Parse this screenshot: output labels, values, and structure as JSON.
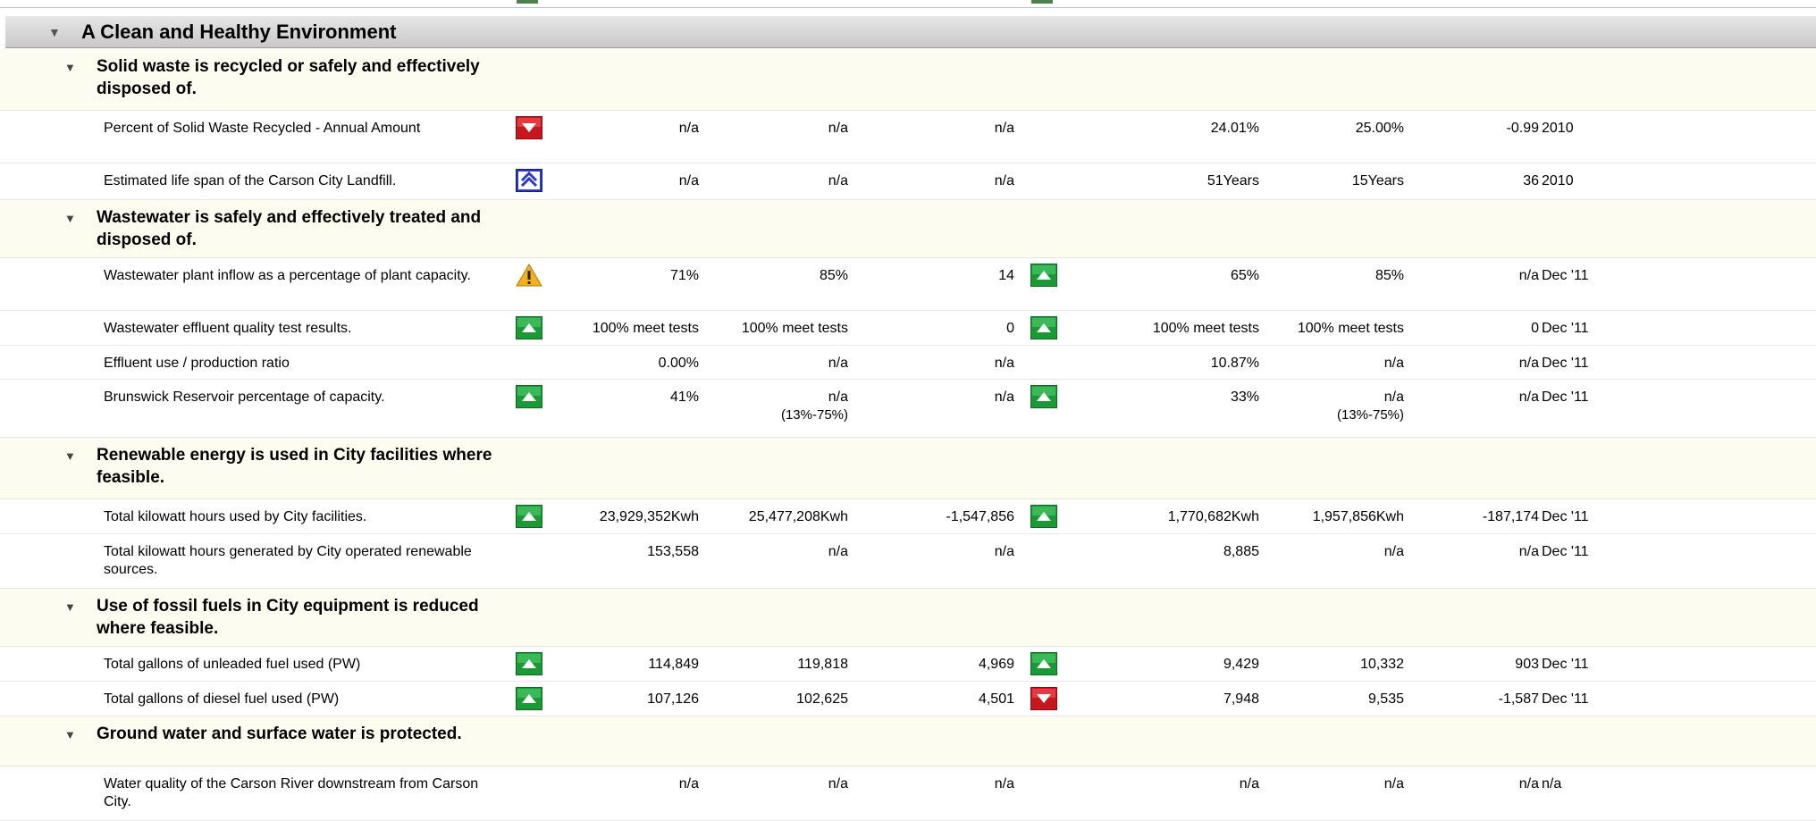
{
  "section": {
    "title": "A Clean and Healthy Environment"
  },
  "groups": [
    {
      "title": "Solid waste is recycled or safely and effectively disposed of.",
      "rows": [
        {
          "name": "Percent of Solid Waste Recycled  - Annual Amount",
          "ind1": "red-down-icon",
          "v1": "n/a",
          "v2": "n/a",
          "v3": "n/a",
          "ind2": "",
          "v4": "24.01%",
          "v5": "25.00%",
          "v6": "-0.99",
          "v7": "2010",
          "sub2": "",
          "sub5": ""
        },
        {
          "name": "Estimated life span of the Carson City Landfill.",
          "ind1": "blue-double-up-icon",
          "v1": "n/a",
          "v2": "n/a",
          "v3": "n/a",
          "ind2": "",
          "v4": "51Years",
          "v5": "15Years",
          "v6": "36",
          "v7": "2010",
          "sub2": "",
          "sub5": ""
        }
      ]
    },
    {
      "title": "Wastewater is safely and effectively treated and disposed of.",
      "rows": [
        {
          "name": "Wastewater plant inflow as a percentage of plant capacity.",
          "ind1": "warning-icon",
          "v1": "71%",
          "v2": "85%",
          "v3": "14",
          "ind2": "green-up-icon",
          "v4": "65%",
          "v5": "85%",
          "v6": "n/a",
          "v7": "Dec '11",
          "sub2": "",
          "sub5": ""
        },
        {
          "name": "Wastewater effluent quality test results.",
          "ind1": "green-up-icon",
          "v1": "100% meet tests",
          "v2": "100% meet tests",
          "v3": "0",
          "ind2": "green-up-icon",
          "v4": "100% meet tests",
          "v5": "100% meet tests",
          "v6": "0",
          "v7": "Dec '11",
          "sub2": "",
          "sub5": ""
        },
        {
          "name": "Effluent use / production ratio",
          "ind1": "",
          "v1": "0.00%",
          "v2": "n/a",
          "v3": "n/a",
          "ind2": "",
          "v4": "10.87%",
          "v5": "n/a",
          "v6": "n/a",
          "v7": "Dec '11",
          "sub2": "",
          "sub5": ""
        },
        {
          "name": "Brunswick Reservoir percentage of capacity.",
          "ind1": "green-up-icon",
          "v1": "41%",
          "v2": "n/a",
          "v3": "n/a",
          "ind2": "green-up-icon",
          "v4": "33%",
          "v5": "n/a",
          "v6": "n/a",
          "v7": "Dec '11",
          "sub2": "(13%-75%)",
          "sub5": "(13%-75%)"
        }
      ]
    },
    {
      "title": "Renewable energy is used in City facilities where feasible.",
      "rows": [
        {
          "name": "Total kilowatt hours used by City facilities.",
          "ind1": "green-up-icon",
          "v1": "23,929,352Kwh",
          "v2": "25,477,208Kwh",
          "v3": "-1,547,856",
          "ind2": "green-up-icon",
          "v4": "1,770,682Kwh",
          "v5": "1,957,856Kwh",
          "v6": "-187,174",
          "v7": "Dec '11",
          "sub2": "",
          "sub5": ""
        },
        {
          "name": "Total kilowatt hours generated by City operated renewable sources.",
          "ind1": "",
          "v1": "153,558",
          "v2": "n/a",
          "v3": "n/a",
          "ind2": "",
          "v4": "8,885",
          "v5": "n/a",
          "v6": "n/a",
          "v7": "Dec '11",
          "sub2": "",
          "sub5": ""
        }
      ]
    },
    {
      "title": "Use of fossil fuels in City equipment is reduced where feasible.",
      "rows": [
        {
          "name": "Total gallons of unleaded fuel used (PW)",
          "ind1": "green-up-icon",
          "v1": "114,849",
          "v2": "119,818",
          "v3": "4,969",
          "ind2": "green-up-icon",
          "v4": "9,429",
          "v5": "10,332",
          "v6": "903",
          "v7": "Dec '11",
          "sub2": "",
          "sub5": ""
        },
        {
          "name": "Total gallons of diesel fuel used (PW)",
          "ind1": "green-up-icon",
          "v1": "107,126",
          "v2": "102,625",
          "v3": "4,501",
          "ind2": "red-down-icon",
          "v4": "7,948",
          "v5": "9,535",
          "v6": "-1,587",
          "v7": "Dec '11",
          "sub2": "",
          "sub5": ""
        }
      ]
    },
    {
      "title": "Ground water and surface water is protected.",
      "rows": [
        {
          "name": "Water quality of the Carson River downstream from Carson City.",
          "ind1": "",
          "v1": "n/a",
          "v2": "n/a",
          "v3": "n/a",
          "ind2": "",
          "v4": "n/a",
          "v5": "n/a",
          "v6": "n/a",
          "v7": "n/a",
          "sub2": "",
          "sub5": ""
        }
      ]
    }
  ]
}
